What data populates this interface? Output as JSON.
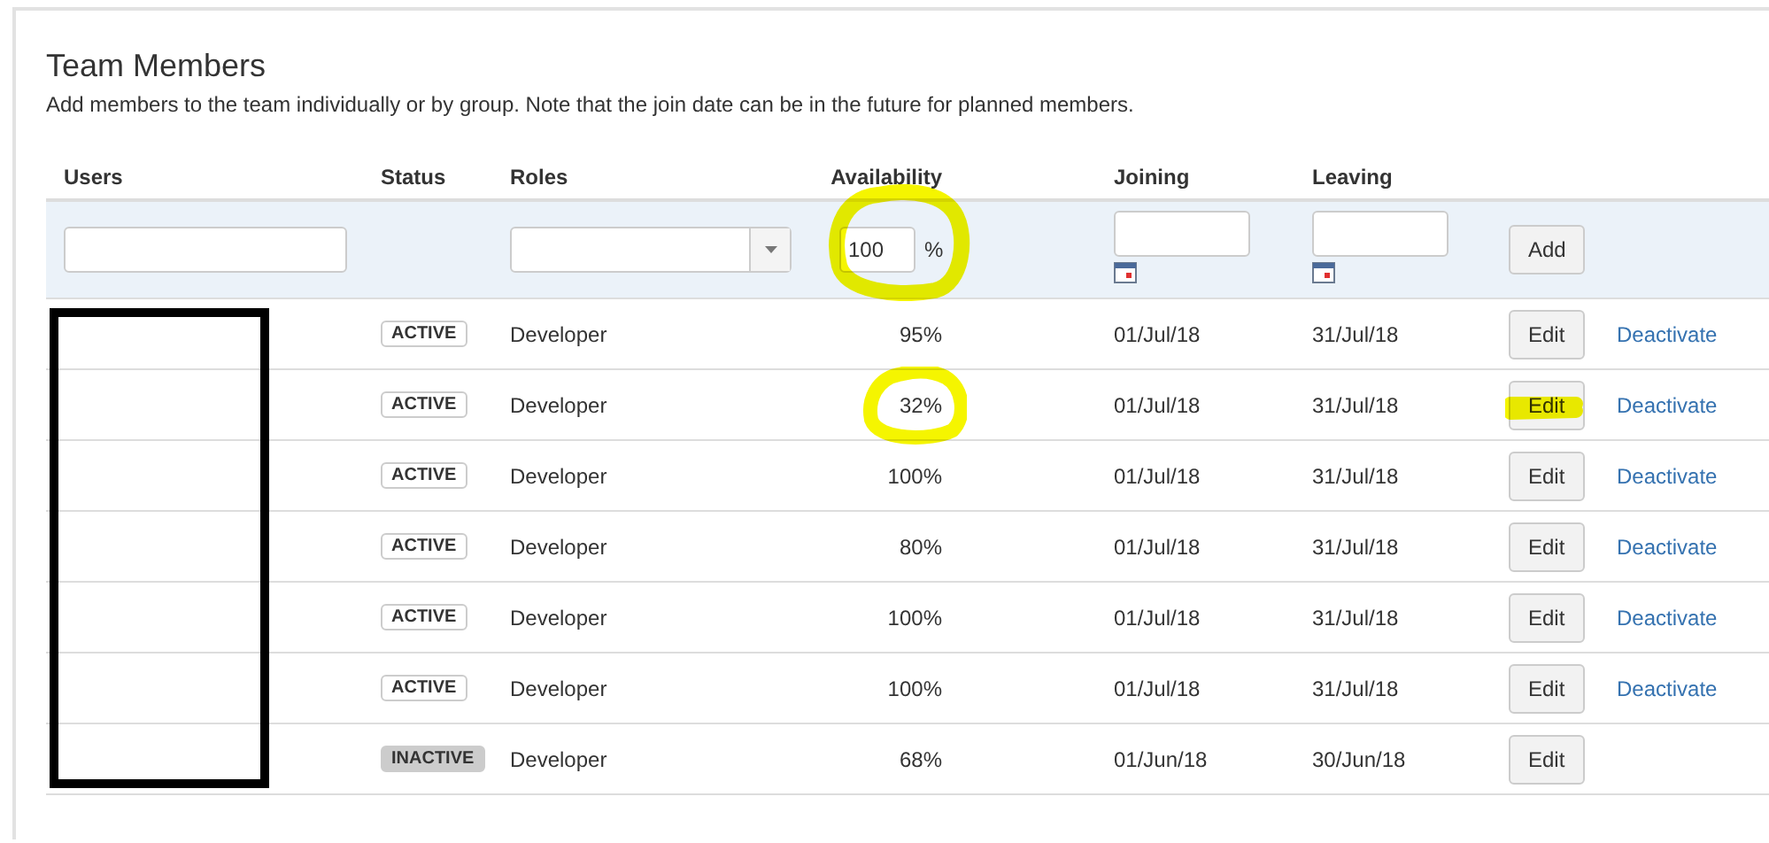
{
  "title": "Team Members",
  "description": "Add members to the team individually or by group. Note that the join date can be in the future for planned members.",
  "columns": [
    "Users",
    "Status",
    "Roles",
    "Availability",
    "Joining",
    "Leaving"
  ],
  "filter": {
    "availability": "100",
    "unit": "%",
    "availability_highlighted": true,
    "add_button": "Add"
  },
  "users_redacted": true,
  "rows": [
    {
      "status": "ACTIVE",
      "kind": "active",
      "role": "Developer",
      "availability": "95%",
      "joining": "01/Jul/18",
      "leaving": "31/Jul/18",
      "edit": "Edit",
      "action": "Deactivate",
      "highlighted_availability": false,
      "highlighted_edit": false
    },
    {
      "status": "ACTIVE",
      "kind": "active",
      "role": "Developer",
      "availability": "32%",
      "joining": "01/Jul/18",
      "leaving": "31/Jul/18",
      "edit": "Edit",
      "action": "Deactivate",
      "highlighted_availability": true,
      "highlighted_edit": true
    },
    {
      "status": "ACTIVE",
      "kind": "active",
      "role": "Developer",
      "availability": "100%",
      "joining": "01/Jul/18",
      "leaving": "31/Jul/18",
      "edit": "Edit",
      "action": "Deactivate",
      "highlighted_availability": false,
      "highlighted_edit": false
    },
    {
      "status": "ACTIVE",
      "kind": "active",
      "role": "Developer",
      "availability": "80%",
      "joining": "01/Jul/18",
      "leaving": "31/Jul/18",
      "edit": "Edit",
      "action": "Deactivate",
      "highlighted_availability": false,
      "highlighted_edit": false
    },
    {
      "status": "ACTIVE",
      "kind": "active",
      "role": "Developer",
      "availability": "100%",
      "joining": "01/Jul/18",
      "leaving": "31/Jul/18",
      "edit": "Edit",
      "action": "Deactivate",
      "highlighted_availability": false,
      "highlighted_edit": false
    },
    {
      "status": "ACTIVE",
      "kind": "active",
      "role": "Developer",
      "availability": "100%",
      "joining": "01/Jul/18",
      "leaving": "31/Jul/18",
      "edit": "Edit",
      "action": "Deactivate",
      "highlighted_availability": false,
      "highlighted_edit": false
    },
    {
      "status": "INACTIVE",
      "kind": "inactive",
      "role": "Developer",
      "availability": "68%",
      "joining": "01/Jun/18",
      "leaving": "30/Jun/18",
      "edit": "Edit",
      "highlighted_availability": false,
      "highlighted_edit": false
    }
  ]
}
